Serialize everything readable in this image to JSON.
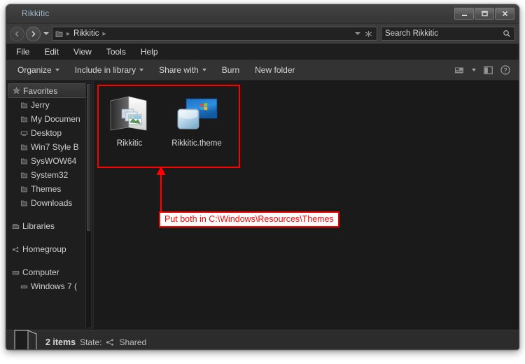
{
  "window": {
    "title": "Rikkitic",
    "controls": [
      {
        "name": "minimize-button",
        "label": "Minimize"
      },
      {
        "name": "maximize-button",
        "label": "Maximize"
      },
      {
        "name": "close-button",
        "label": "Close"
      }
    ]
  },
  "address_bar": {
    "back_label": "Back",
    "forward_label": "Forward",
    "recent_label": "Recent pages",
    "folder_icon": "folder-icon",
    "crumb": "Rikkitic",
    "previous_locations_label": "Previous locations",
    "refresh_label": "Refresh"
  },
  "search": {
    "placeholder": "Search Rikkitic",
    "icon": "search-icon"
  },
  "menu": {
    "items": [
      {
        "label": "File"
      },
      {
        "label": "Edit"
      },
      {
        "label": "View"
      },
      {
        "label": "Tools"
      },
      {
        "label": "Help"
      }
    ]
  },
  "toolbar": {
    "items": [
      {
        "label": "Organize",
        "caret": true
      },
      {
        "label": "Include in library",
        "caret": true
      },
      {
        "label": "Share with",
        "caret": true
      },
      {
        "label": "Burn",
        "caret": false
      },
      {
        "label": "New folder",
        "caret": false
      }
    ],
    "view_icon": "view-mode-icon",
    "view_caret": "chevron-down-icon",
    "preview_icon": "preview-pane-icon",
    "help_icon": "help-icon"
  },
  "sidebar": {
    "items": [
      {
        "label": "Favorites",
        "icon": "star-icon",
        "level": "root",
        "selected": true
      },
      {
        "label": "Jerry",
        "icon": "folder-icon",
        "level": "child"
      },
      {
        "label": "My Documen",
        "icon": "folder-icon",
        "level": "child"
      },
      {
        "label": "Desktop",
        "icon": "desktop-icon",
        "level": "child"
      },
      {
        "label": "Win7 Style B",
        "icon": "folder-icon",
        "level": "child"
      },
      {
        "label": "SysWOW64",
        "icon": "folder-icon",
        "level": "child"
      },
      {
        "label": "System32",
        "icon": "folder-icon",
        "level": "child"
      },
      {
        "label": "Themes",
        "icon": "folder-icon",
        "level": "child"
      },
      {
        "label": "Downloads",
        "icon": "folder-icon",
        "level": "child"
      },
      {
        "label": "Libraries",
        "icon": "libraries-icon",
        "level": "root"
      },
      {
        "label": "Homegroup",
        "icon": "homegroup-icon",
        "level": "root"
      },
      {
        "label": "Computer",
        "icon": "computer-icon",
        "level": "root"
      },
      {
        "label": "Windows 7 (",
        "icon": "drive-icon",
        "level": "child"
      }
    ]
  },
  "content": {
    "files": [
      {
        "name": "Rikkitic",
        "icon": "pictures-folder-icon"
      },
      {
        "name": "Rikkitic.theme",
        "icon": "theme-file-icon"
      }
    ]
  },
  "annotation": {
    "text": "Put both in C:\\Windows\\Resources\\Themes",
    "arrow_icon": "up-arrow-icon",
    "color": "#ff0000",
    "background": "#ffffff"
  },
  "status_bar": {
    "folder_icon": "large-folder-icon",
    "item_count": "2 items",
    "state_label": "State:",
    "share_icon": "shared-icon",
    "state_value": "Shared"
  }
}
